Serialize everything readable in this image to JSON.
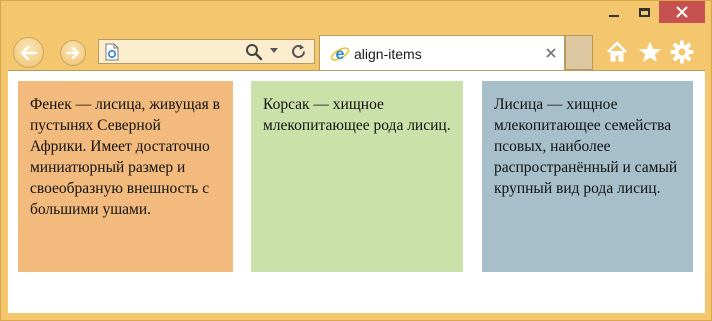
{
  "window": {
    "colors": {
      "frame": "#f4c76e",
      "close_button": "#c75050"
    }
  },
  "toolbar": {
    "back_icon": "back-arrow-icon",
    "forward_icon": "forward-arrow-icon",
    "address": {
      "value": "",
      "page_icon": "page-icon",
      "search_icon": "search-icon",
      "dropdown_icon": "chevron-down-icon",
      "refresh_icon": "refresh-icon"
    },
    "tab": {
      "title": "align-items",
      "icon": "ie-logo-icon",
      "close_icon": "close-icon"
    },
    "right_icons": [
      "home-icon",
      "star-icon",
      "gear-icon"
    ]
  },
  "content": {
    "cards": [
      {
        "text": "Фенек — лисица, живущая в пустынях Северной Африки. Имеет достаточно миниатюрный размер и своеобразную внешность с большими ушами.",
        "color": "#f2bb7d"
      },
      {
        "text": "Корсак — хищное млекопитающее рода лисиц.",
        "color": "#cbe1aa"
      },
      {
        "text": "Лисица — хищное млекопитающее семейства псовых, наиболее распространённый и самый крупный вид рода лисиц.",
        "color": "#a6bfcb"
      }
    ]
  }
}
